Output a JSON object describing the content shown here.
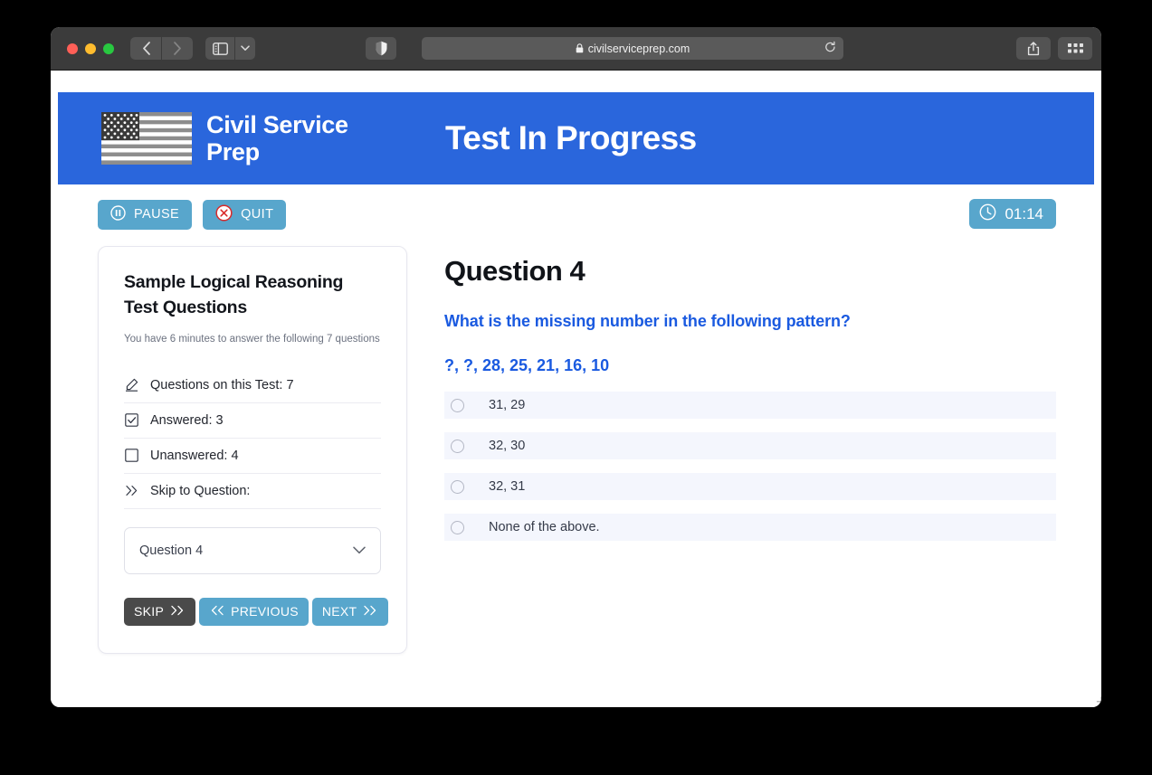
{
  "browser": {
    "url": "civilserviceprep.com",
    "lock_icon": "lock-icon",
    "back_icon": "back-arrow-icon",
    "forward_icon": "forward-arrow-icon",
    "sidebar_icon": "sidebar-toggle-icon",
    "sidebar_chevron_icon": "chevron-down-icon",
    "shield_icon": "privacy-shield-icon",
    "reload_icon": "reload-icon",
    "share_icon": "share-icon",
    "tabs_overview_icon": "tab-grid-icon",
    "new_tab_label": "+"
  },
  "header": {
    "brand_name": "Civil Service Prep",
    "logo_icon": "us-flag-icon",
    "title": "Test In Progress",
    "background_color": "#2a66dc"
  },
  "controls": {
    "pause_label": "PAUSE",
    "pause_icon": "pause-circle-icon",
    "quit_label": "QUIT",
    "quit_icon": "close-circle-icon",
    "timer_value": "01:14",
    "timer_icon": "clock-icon",
    "button_color": "#58a6cc"
  },
  "sidebar": {
    "title": "Sample Logical Reasoning Test Questions",
    "subtitle": "You have 6 minutes to answer the following 7 questions",
    "stats": [
      {
        "icon": "pencil-icon",
        "label": "Questions on this Test: 7"
      },
      {
        "icon": "checked-box-icon",
        "label": "Answered: 3"
      },
      {
        "icon": "empty-box-icon",
        "label": "Unanswered: 4"
      },
      {
        "icon": "double-chevron-right-icon",
        "label": "Skip to Question:"
      }
    ],
    "question_select": {
      "value": "Question 4",
      "chevron_icon": "chevron-down-icon"
    },
    "buttons": {
      "skip_label": "SKIP",
      "skip_icon": "double-chevron-right-icon",
      "skip_color": "#4a4a4a",
      "previous_label": "PREVIOUS",
      "previous_icon": "double-chevron-left-icon",
      "next_label": "NEXT",
      "next_icon": "double-chevron-right-icon"
    }
  },
  "question": {
    "number_label": "Question 4",
    "prompt": "What is the missing number in the following pattern?",
    "pattern": "?, ?, 28, 25, 21, 16, 10",
    "accent_color": "#1a5ae0",
    "options": [
      {
        "label": "31, 29",
        "selected": false
      },
      {
        "label": "32, 30",
        "selected": false
      },
      {
        "label": "32, 31",
        "selected": false
      },
      {
        "label": "None of the above.",
        "selected": false
      }
    ]
  }
}
